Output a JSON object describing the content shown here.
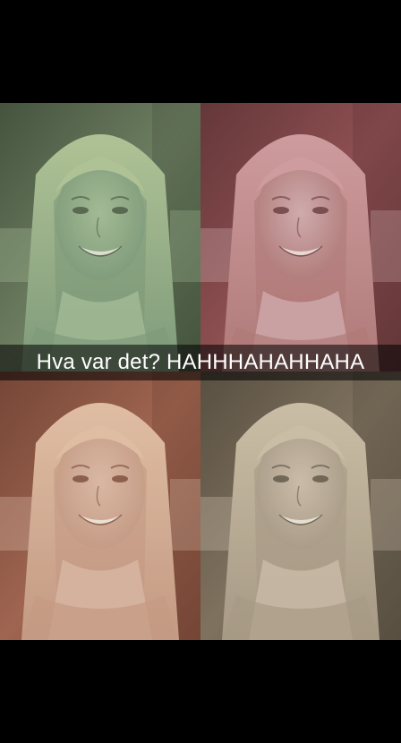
{
  "snap": {
    "caption": "Hva var det? HAHHHAHAHHAHA"
  },
  "collage": {
    "tiles": [
      {
        "position": "top-left",
        "tint": "#7f9a7a",
        "tint_dark": "#3e4a36",
        "hair": "#b7c89a",
        "skin": "#a9bf98",
        "background": "#6c7a5e"
      },
      {
        "position": "top-right",
        "tint": "#b07a78",
        "tint_dark": "#5a2e30",
        "hair": "#d3a0a3",
        "skin": "#d5b2b4",
        "background": "#8a4a4c"
      },
      {
        "position": "bottom-left",
        "tint": "#c49a84",
        "tint_dark": "#6a3a2c",
        "hair": "#e3c2a8",
        "skin": "#dcbca8",
        "background": "#9a5e4a"
      },
      {
        "position": "bottom-right",
        "tint": "#a89a86",
        "tint_dark": "#4e4538",
        "hair": "#cfc2aa",
        "skin": "#cfc0ae",
        "background": "#7a6c5a"
      }
    ]
  }
}
